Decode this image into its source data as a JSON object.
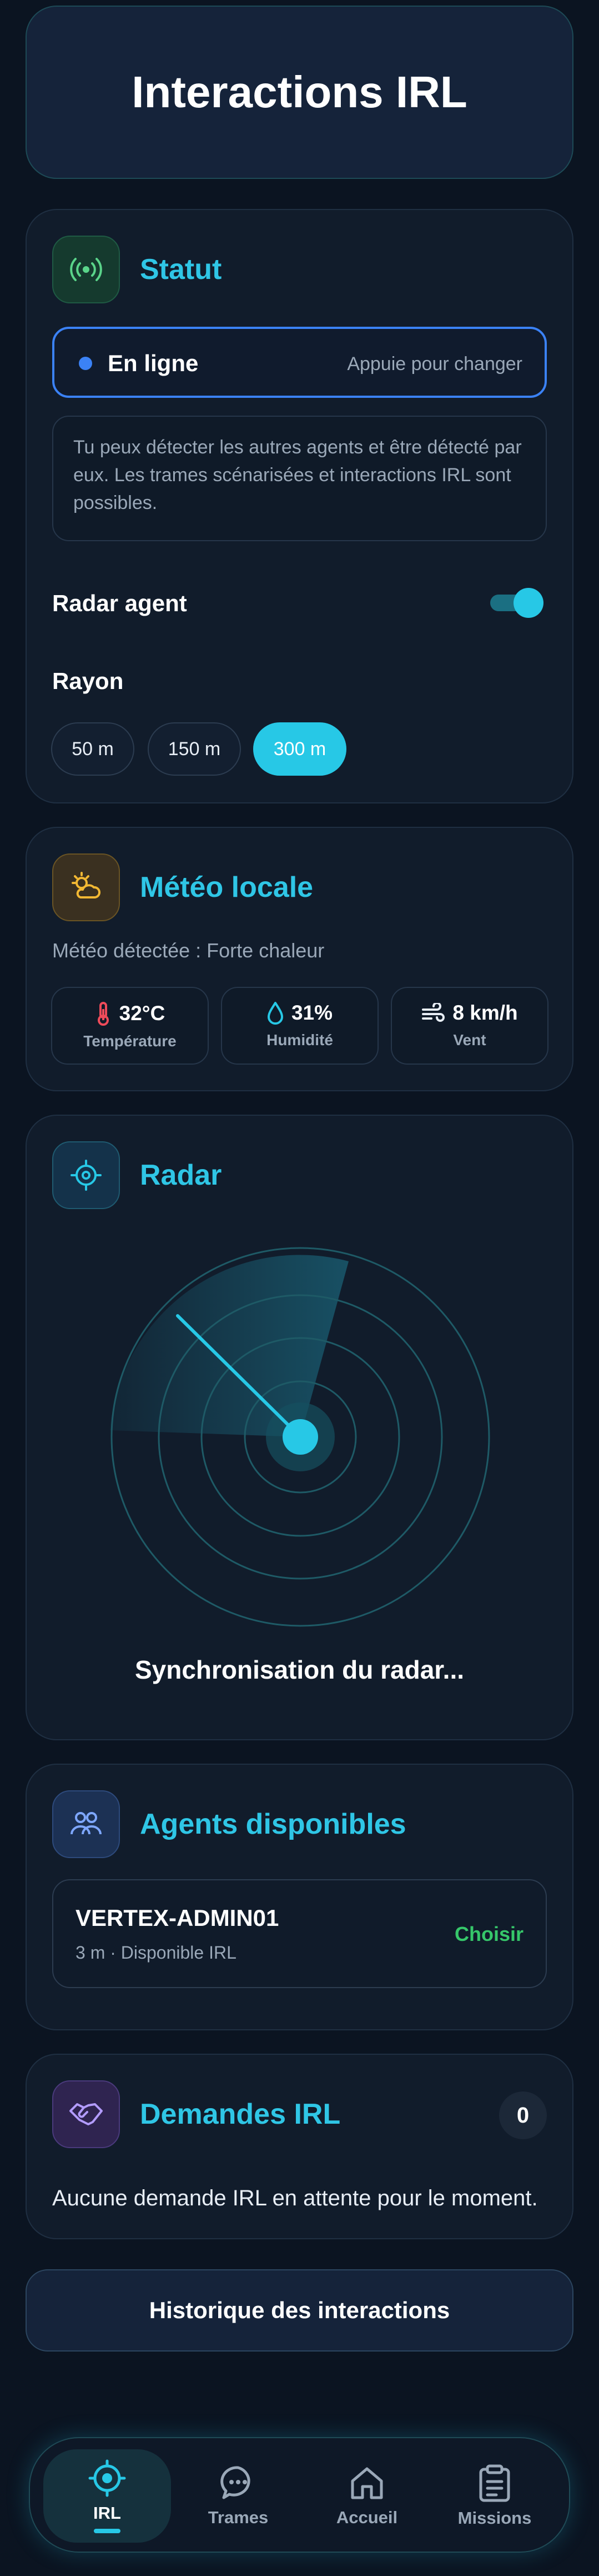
{
  "page": {
    "title": "Interactions IRL"
  },
  "status": {
    "title": "Statut",
    "current": "En ligne",
    "hint": "Appuie pour changer",
    "description": "Tu peux détecter les autres agents et être détecté par eux. Les trames scénarisées et interactions IRL sont possibles.",
    "radar_label": "Radar agent",
    "radar_enabled": true,
    "range_label": "Rayon",
    "ranges": [
      "50 m",
      "150 m",
      "300 m"
    ],
    "selected_range": "300 m"
  },
  "weather": {
    "title": "Météo locale",
    "detected": "Météo détectée : Forte chaleur",
    "tiles": [
      {
        "value": "32°C",
        "label": "Température",
        "icon": "thermometer-icon"
      },
      {
        "value": "31%",
        "label": "Humidité",
        "icon": "droplet-icon"
      },
      {
        "value": "8 km/h",
        "label": "Vent",
        "icon": "wind-icon"
      }
    ]
  },
  "radar": {
    "title": "Radar",
    "sync_text": "Synchronisation du radar..."
  },
  "agents": {
    "title": "Agents disponibles",
    "list": [
      {
        "name": "VERTEX-ADMIN01",
        "meta": "3 m · Disponible IRL",
        "action": "Choisir"
      }
    ]
  },
  "requests": {
    "title": "Demandes IRL",
    "count": "0",
    "empty": "Aucune demande IRL en attente pour le moment."
  },
  "history": {
    "label": "Historique des interactions"
  },
  "nav": {
    "items": [
      {
        "label": "IRL",
        "icon": "radar-target-icon",
        "active": true
      },
      {
        "label": "Trames",
        "icon": "chat-bubble-icon",
        "active": false
      },
      {
        "label": "Accueil",
        "icon": "home-icon",
        "active": false
      },
      {
        "label": "Missions",
        "icon": "clipboard-icon",
        "active": false
      }
    ]
  },
  "colors": {
    "accent": "#27c8e6",
    "online": "#3b82f6",
    "choose": "#36c76a",
    "background": "#0b1421"
  }
}
